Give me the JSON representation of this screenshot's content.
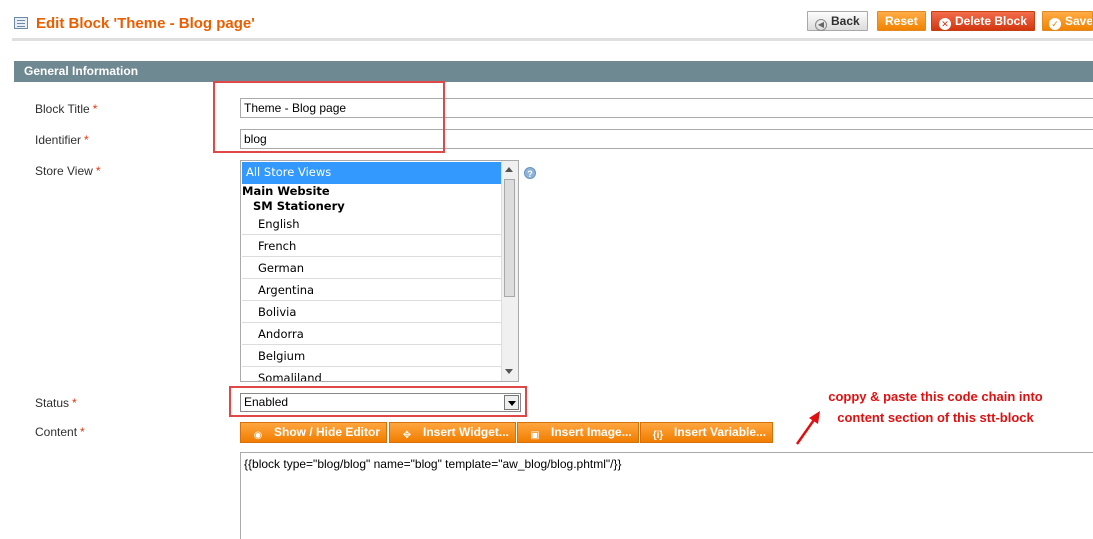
{
  "header": {
    "title": "Edit Block 'Theme - Blog page'",
    "icon": "grid-icon",
    "buttons": {
      "back": "Back",
      "reset": "Reset",
      "delete": "Delete Block",
      "save": "Save"
    }
  },
  "section": {
    "title": "General Information"
  },
  "form": {
    "block_title": {
      "label": "Block Title",
      "required": "*",
      "value": "Theme - Blog page"
    },
    "identifier": {
      "label": "Identifier",
      "required": "*",
      "value": "blog"
    },
    "store_view": {
      "label": "Store View",
      "required": "*",
      "selected": "All Store Views",
      "group": "Main Website",
      "store": "SM Stationery",
      "options": [
        "English",
        "French",
        "German",
        "Argentina",
        "Bolivia",
        "Andorra",
        "Belgium",
        "Somaliland"
      ]
    },
    "status": {
      "label": "Status",
      "required": "*",
      "value": "Enabled"
    },
    "content": {
      "label": "Content",
      "required": "*",
      "buttons": {
        "show_hide": "Show / Hide Editor",
        "widget": "Insert Widget...",
        "image": "Insert Image...",
        "variable": "Insert Variable..."
      },
      "value": "{{block type=\"blog/blog\" name=\"blog\" template=\"aw_blog/blog.phtml\"/}}"
    }
  },
  "annotation": {
    "line1": "coppy & paste this code chain into",
    "line2": "content section of this stt-block",
    "color": "#e01010"
  },
  "colors": {
    "accent": "#eb5e00",
    "section_bar": "#6f8992",
    "button_orange": "#f18200",
    "highlight": "#e04848"
  }
}
